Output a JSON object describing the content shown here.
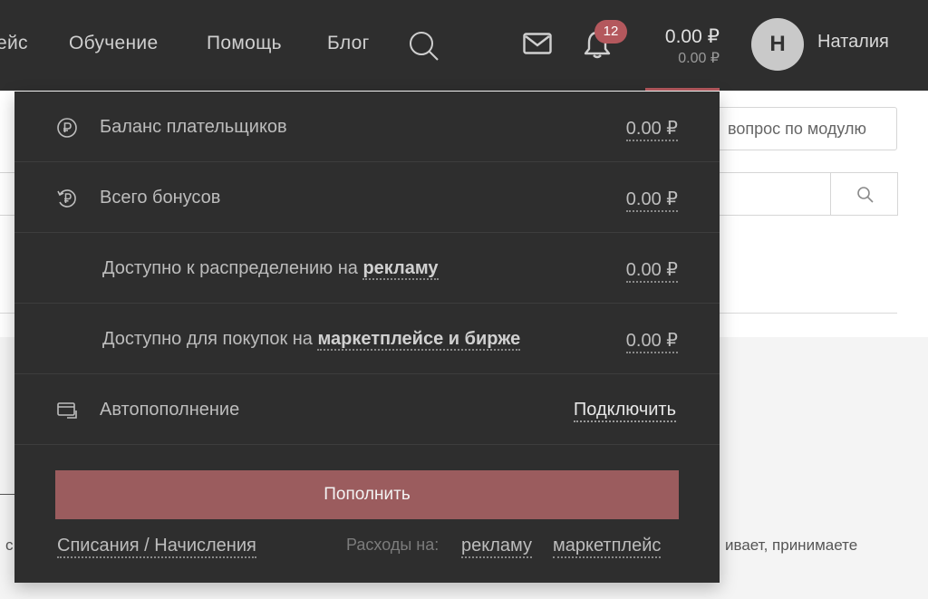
{
  "nav": {
    "items": [
      "ейс",
      "Обучение",
      "Помощь",
      "Блог"
    ]
  },
  "notifications": {
    "count": "12"
  },
  "balance": {
    "main": "0.00 ₽",
    "sub": "0.00 ₽"
  },
  "user": {
    "initial": "Н",
    "name": "Наталия"
  },
  "background": {
    "question_button": "вопрос по модулю",
    "text_left": "с",
    "text_right": "ивает, принимаете"
  },
  "dropdown": {
    "payer_balance": {
      "label": "Баланс плательщиков",
      "value": "0.00 ₽"
    },
    "total_bonuses": {
      "label": "Всего бонусов",
      "value": "0.00 ₽"
    },
    "available_ads": {
      "label": "Доступно к распределению на",
      "link": "рекламу",
      "value": "0.00 ₽"
    },
    "available_market": {
      "label": "Доступно для покупок на",
      "link": "маркетплейсе и бирже",
      "value": "0.00 ₽"
    },
    "autopay": {
      "label": "Автопополнение",
      "action": "Подключить"
    },
    "topup_button": "Пополнить",
    "footer": {
      "history_link": "Списания / Начисления",
      "expenses_caption": "Расходы на:",
      "ads_link": "рекламу",
      "market_link": "маркетплейс"
    }
  },
  "colors": {
    "topbar": "#2e2e2e",
    "accent": "#b4585d",
    "button": "#9b5c5e"
  }
}
